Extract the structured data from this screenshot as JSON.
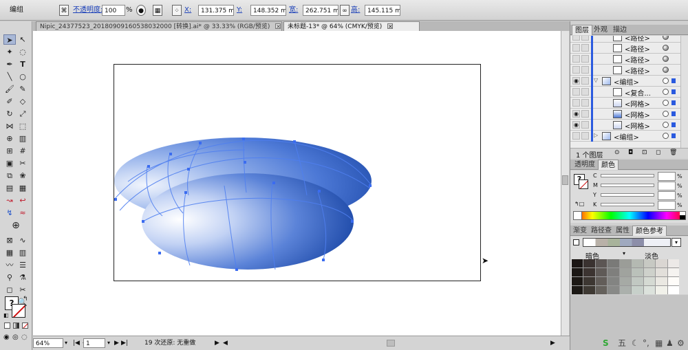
{
  "control_bar": {
    "selection_label": "编组",
    "opacity_label": "不透明度:",
    "opacity_value": "100",
    "opacity_unit": "%",
    "x_label": "X:",
    "x_value": "131.375 mm",
    "y_label": "Y:",
    "y_value": "148.352 mm",
    "w_label": "宽:",
    "w_value": "262.751 mi",
    "h_label": "高:",
    "h_value": "145.115 mi"
  },
  "document_tabs": [
    {
      "label": "Nipic_24377523_20180909160538032000 [转换].ai* @ 33.33% (RGB/预览)",
      "active": false
    },
    {
      "label": "未标题-13* @ 64% (CMYK/预览)",
      "active": true
    }
  ],
  "layers_panel": {
    "tabs": [
      "图层",
      "外观",
      "描边"
    ],
    "rows": [
      {
        "name": "<路径>",
        "visible": false,
        "thumb": "path",
        "filled": true
      },
      {
        "name": "<路径>",
        "visible": false,
        "thumb": "path",
        "filled": true
      },
      {
        "name": "<路径>",
        "visible": false,
        "thumb": "path",
        "filled": true
      },
      {
        "name": "<路径>",
        "visible": false,
        "thumb": "path",
        "filled": true
      },
      {
        "name": "<编组>",
        "visible": true,
        "thumb": "group",
        "filled": false,
        "expanded": true
      },
      {
        "name": "<复合...",
        "visible": false,
        "thumb": "path",
        "filled": false
      },
      {
        "name": "<网格>",
        "visible": false,
        "thumb": "mesh",
        "filled": false
      },
      {
        "name": "<网格>",
        "visible": true,
        "thumb": "mesh-blue",
        "filled": false
      },
      {
        "name": "<网格>",
        "visible": true,
        "thumb": "mesh",
        "filled": false
      },
      {
        "name": "<编组>",
        "visible": false,
        "thumb": "group",
        "filled": false,
        "expanded": false
      }
    ],
    "footer": "1 个图层"
  },
  "color_panel": {
    "tabs": [
      "透明度",
      "颜色"
    ],
    "channels": [
      "C",
      "M",
      "Y",
      "K"
    ],
    "unit": "%"
  },
  "color_guide_panel": {
    "tabs": [
      "渐变",
      "路径查",
      "属性",
      "颜色参考"
    ],
    "dark_label": "暗色",
    "light_label": "淡色"
  },
  "status_bar": {
    "zoom": "64%",
    "page": "1",
    "undo_text": "19 次还原: 无重做"
  },
  "taskbar": {
    "icons": [
      "input-method-icon",
      "moon-icon",
      "punctuation-icon",
      "keyboard-icon",
      "user-icon",
      "gear-icon"
    ],
    "ime_label": "五"
  },
  "colors": {
    "accent": "#2a5adf",
    "mesh_blue_light": "#e6ecfb",
    "mesh_blue_dark": "#1d49a8"
  }
}
